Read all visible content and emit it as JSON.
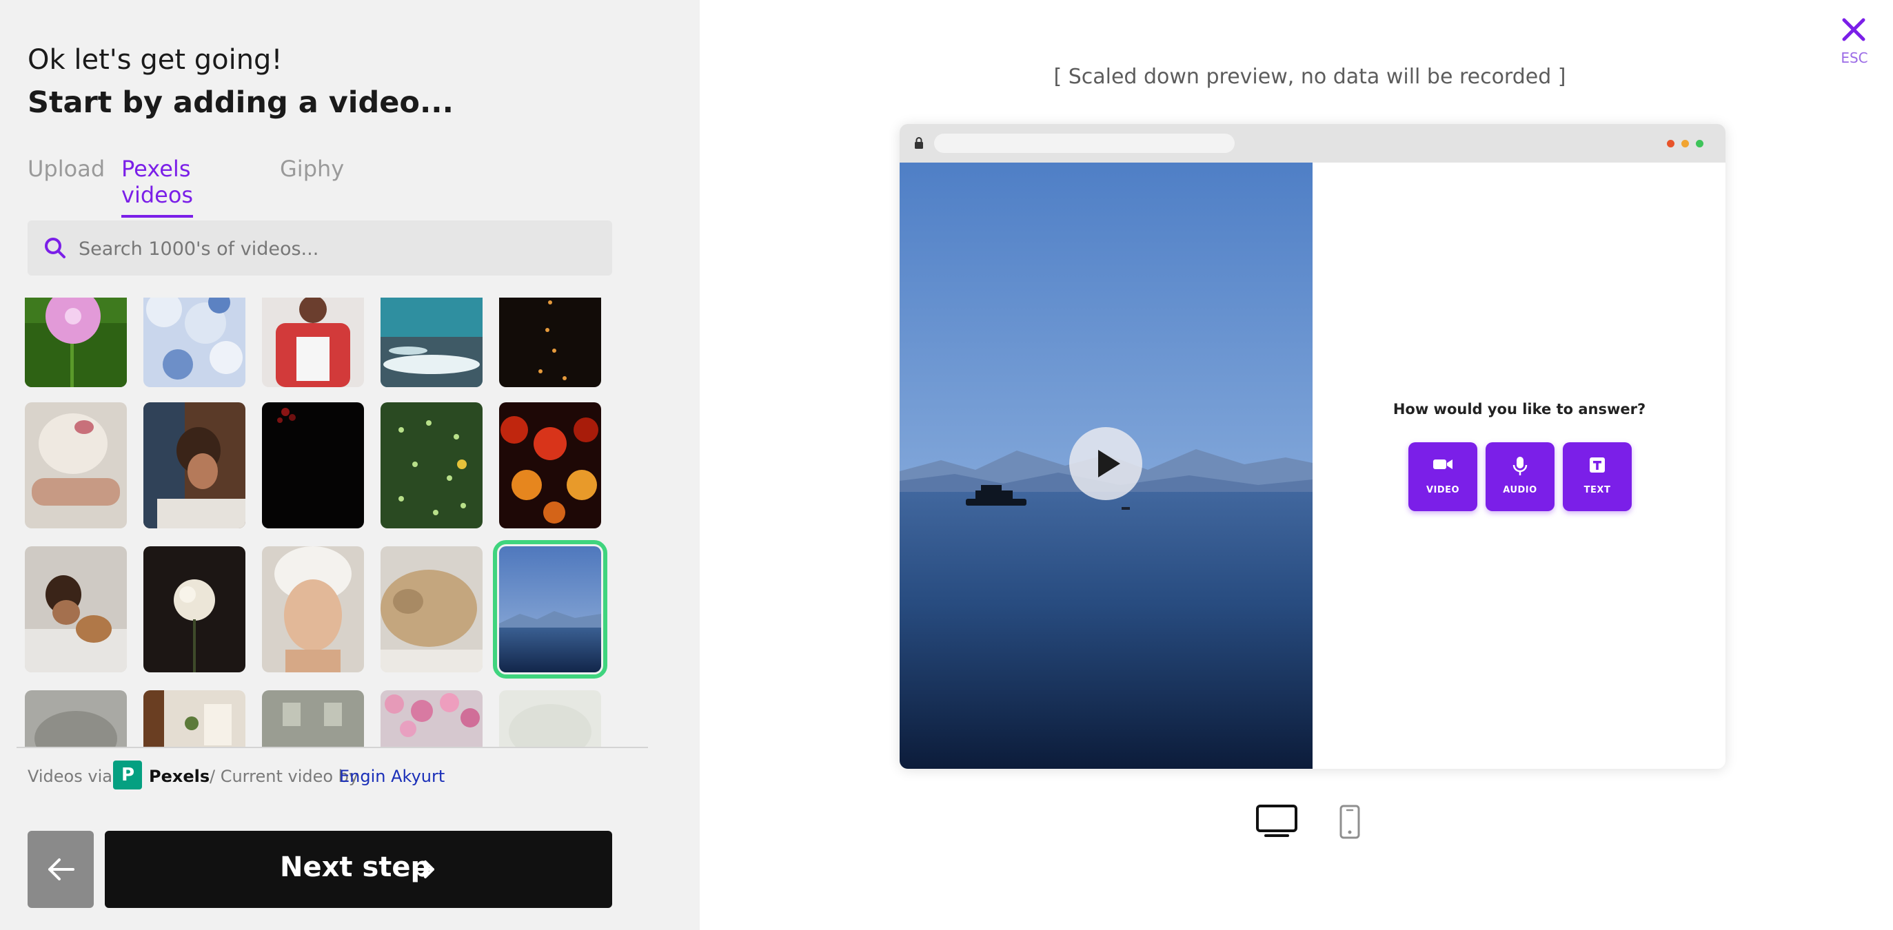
{
  "intro": {
    "line1": "Ok let's get going!",
    "line2": "Start by adding a video..."
  },
  "tabs": [
    {
      "label": "Upload",
      "active": false
    },
    {
      "label": "Pexels videos",
      "active": true
    },
    {
      "label": "Giphy",
      "active": false
    }
  ],
  "search": {
    "placeholder": "Search 1000's of videos...",
    "value": ""
  },
  "credits": {
    "prefix": "Videos via",
    "brand": "Pexels",
    "middle": "/ Current video by",
    "author": "Engin Akyurt"
  },
  "actions": {
    "back_icon": "arrow-left-icon",
    "next_label": "Next step",
    "next_icon": "arrow-right-icon"
  },
  "preview": {
    "note": "[ Scaled down preview, no data will be recorded ]",
    "close_icon": "close-icon",
    "esc_label": "ESC",
    "question": "How would you like to answer?",
    "answer_buttons": [
      {
        "label": "VIDEO",
        "icon": "video-camera-icon"
      },
      {
        "label": "AUDIO",
        "icon": "microphone-icon"
      },
      {
        "label": "TEXT",
        "icon": "text-icon"
      }
    ],
    "devices": [
      {
        "name": "desktop",
        "active": true
      },
      {
        "name": "mobile",
        "active": false
      }
    ]
  },
  "colors": {
    "accent": "#7b1fe8",
    "selected_outline": "#3fd47e",
    "pexels_green": "#05a081",
    "link": "#1a2fb8"
  }
}
